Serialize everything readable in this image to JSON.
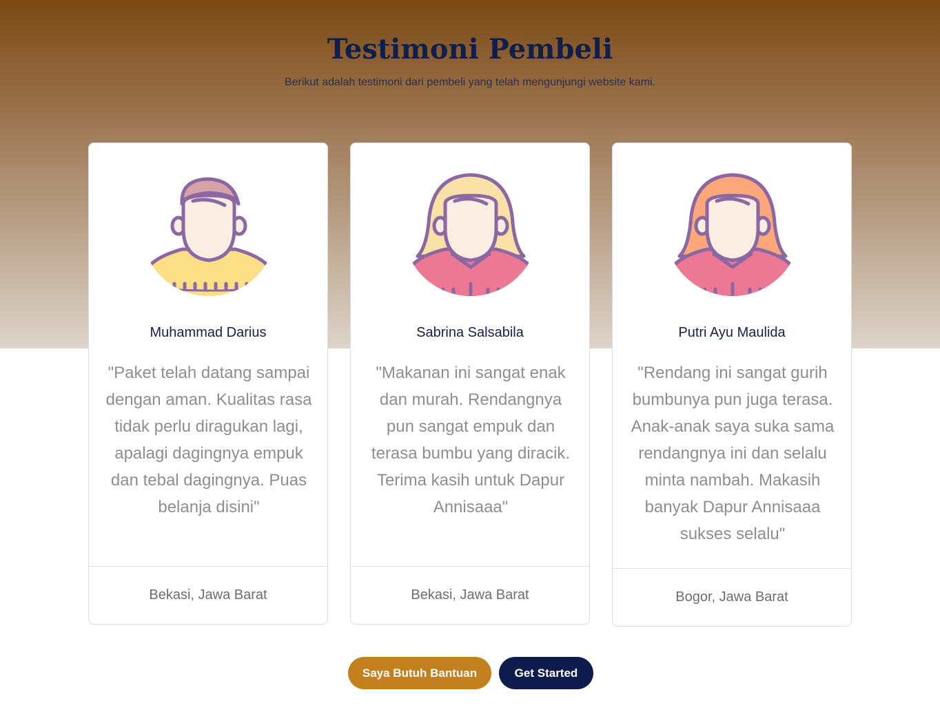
{
  "section": {
    "title": "Testimoni Pembeli",
    "subtitle": "Berikut adalah testimoni dari pembeli yang telah mengunjungi website kami."
  },
  "testimonials": [
    {
      "name": "Muhammad Darius",
      "quote": "\"Paket telah datang sampai dengan aman. Kualitas rasa tidak perlu diragukan lagi, apalagi dagingnya empuk dan tebal dagingnya. Puas belanja disini\"",
      "location": "Bekasi, Jawa Barat",
      "avatar": "male-avatar-icon"
    },
    {
      "name": "Sabrina Salsabila",
      "quote": "\"Makanan ini sangat enak dan murah. Rendangnya pun sangat empuk dan terasa bumbu yang diracik. Terima kasih untuk Dapur Annisaaa\"",
      "location": "Bekasi, Jawa Barat",
      "avatar": "female-avatar-icon"
    },
    {
      "name": "Putri Ayu Maulida",
      "quote": "\"Rendang ini sangat gurih bumbunya pun juga terasa. Anak-anak saya suka sama rendangnya ini dan selalu minta nambah. Makasih banyak Dapur Annisaaa sukses selalu\"",
      "location": "Bogor, Jawa Barat",
      "avatar": "female-avatar-icon"
    }
  ],
  "buttons": {
    "help_label": "Saya Butuh Bantuan",
    "start_label": "Get Started"
  },
  "colors": {
    "hero_top": "#7b4912",
    "title": "#0f1e4a",
    "help_button": "#c47f1e",
    "start_button": "#0e1c4d"
  }
}
